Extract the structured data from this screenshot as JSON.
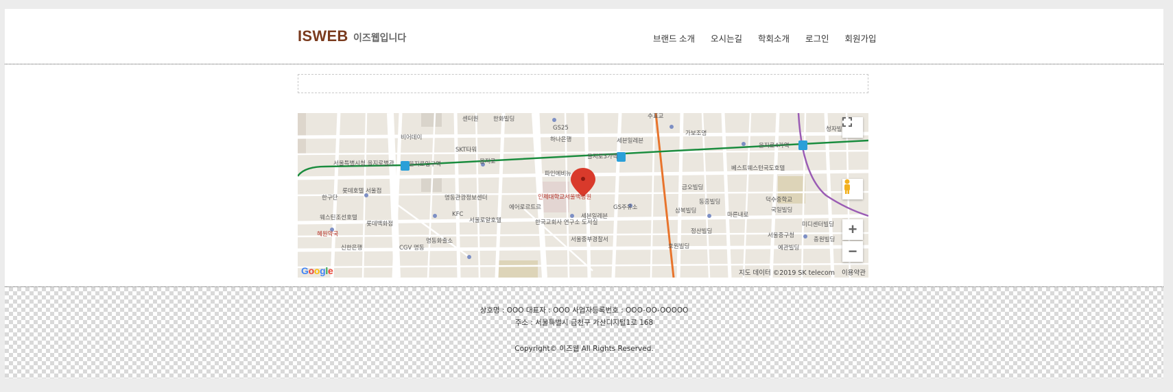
{
  "header": {
    "logo": "ISWEB",
    "tagline": "이즈웹입니다",
    "nav": [
      "브랜드 소개",
      "오시는길",
      "학회소개",
      "로그인",
      "회원가입"
    ]
  },
  "map": {
    "labels": [
      {
        "text": "센터원",
        "pos": "top"
      },
      {
        "text": "한화빌딩"
      },
      {
        "text": "수표교"
      },
      {
        "text": "GS25"
      },
      {
        "text": "하나은행"
      },
      {
        "text": "세븐일레븐"
      },
      {
        "text": "가보조명"
      },
      {
        "text": "청자빌딩"
      },
      {
        "text": "비어데이"
      },
      {
        "text": "SKT타워"
      },
      {
        "text": "을지로3가역"
      },
      {
        "text": "을지로4가역"
      },
      {
        "text": "을지로입구역"
      },
      {
        "text": "서울특별시청 을지로별관"
      },
      {
        "text": "을지로"
      },
      {
        "text": "파인에비뉴"
      },
      {
        "text": "인제대학교서울백병원"
      },
      {
        "text": "베스트웨스턴국도호텔"
      },
      {
        "text": "금오빌딩"
      },
      {
        "text": "롯데호텔 서울점"
      },
      {
        "text": "명동관광정보센터"
      },
      {
        "text": "에어로르트르"
      },
      {
        "text": "GS주유소"
      },
      {
        "text": "동흥빌딩"
      },
      {
        "text": "덕수중학교"
      },
      {
        "text": "한구단"
      },
      {
        "text": "웨스틴조선호텔"
      },
      {
        "text": "롯데백화점"
      },
      {
        "text": "서울로얄호텔"
      },
      {
        "text": "KFC"
      },
      {
        "text": "삼복빌딩"
      },
      {
        "text": "국일빌딩"
      },
      {
        "text": "마른내로"
      },
      {
        "text": "세븐일레븐"
      },
      {
        "text": "한국교회사 연구소 도서실"
      },
      {
        "text": "정산빌딩"
      },
      {
        "text": "미디센터빌딩"
      },
      {
        "text": "서울중구청"
      },
      {
        "text": "혜원약국"
      },
      {
        "text": "신한은행"
      },
      {
        "text": "CGV 명동"
      },
      {
        "text": "명동화출소"
      },
      {
        "text": "서울중부경찰서"
      },
      {
        "text": "호원빌딩"
      },
      {
        "text": "예관빌딩"
      },
      {
        "text": "충원빌딩"
      }
    ],
    "google_logo": "Google",
    "attribution": "지도 데이터 ©2019 SK telecom",
    "terms": "이용약관",
    "zoom_in": "+",
    "zoom_out": "−"
  },
  "footer": {
    "line1": "상호명 : OOO 대표자 : OOO 사업자등록번호 : OOO-OO-OOOOO",
    "line2": "주소 : 서울특별시 금천구 가산디지털1로 168",
    "copyright": "Copyright© 이즈웹 All Rights Reserved."
  },
  "colors": {
    "logo": "#7a3b1e",
    "subway_line2": "#1a8c3e",
    "subway_line5": "#9a5cb4",
    "main_road": "#e8742c",
    "marker": "#d93a2b"
  }
}
